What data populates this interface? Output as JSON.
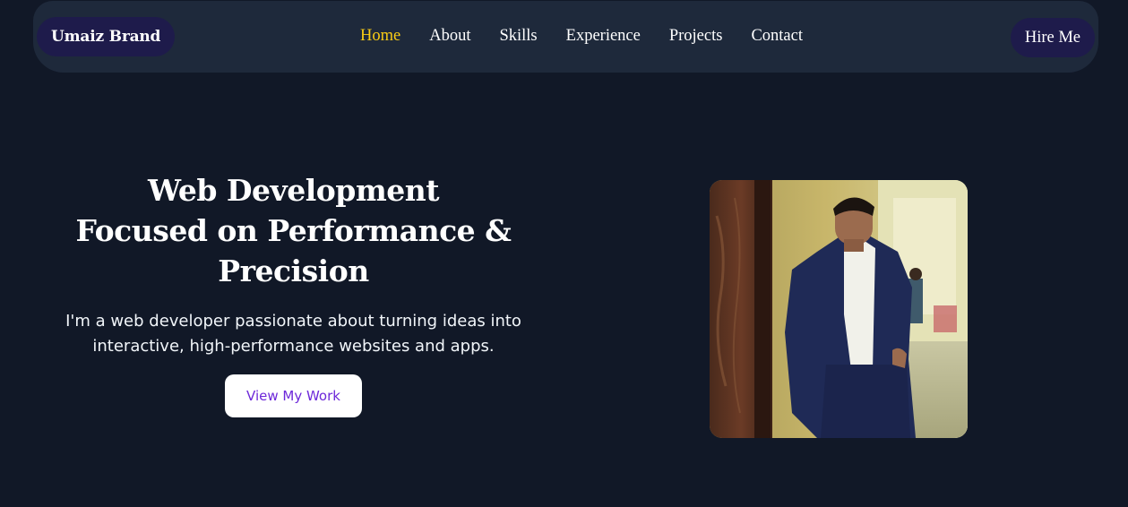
{
  "nav": {
    "brand": "Umaiz Brand",
    "links": [
      {
        "label": "Home",
        "active": true
      },
      {
        "label": "About",
        "active": false
      },
      {
        "label": "Skills",
        "active": false
      },
      {
        "label": "Experience",
        "active": false
      },
      {
        "label": "Projects",
        "active": false
      },
      {
        "label": "Contact",
        "active": false
      }
    ],
    "cta": "Hire Me"
  },
  "hero": {
    "title_lines": [
      "Web Development",
      "Focused on Performance &",
      "Precision"
    ],
    "subtitle_lines": [
      "I'm a web developer passionate about turning ideas into",
      "interactive, high-performance websites and apps."
    ],
    "button": "View My Work"
  },
  "colors": {
    "background": "#111827",
    "navbar": "#1e293b",
    "pill": "#1e1b4b",
    "active_link": "#facc15",
    "button_text": "#6d28d9"
  }
}
